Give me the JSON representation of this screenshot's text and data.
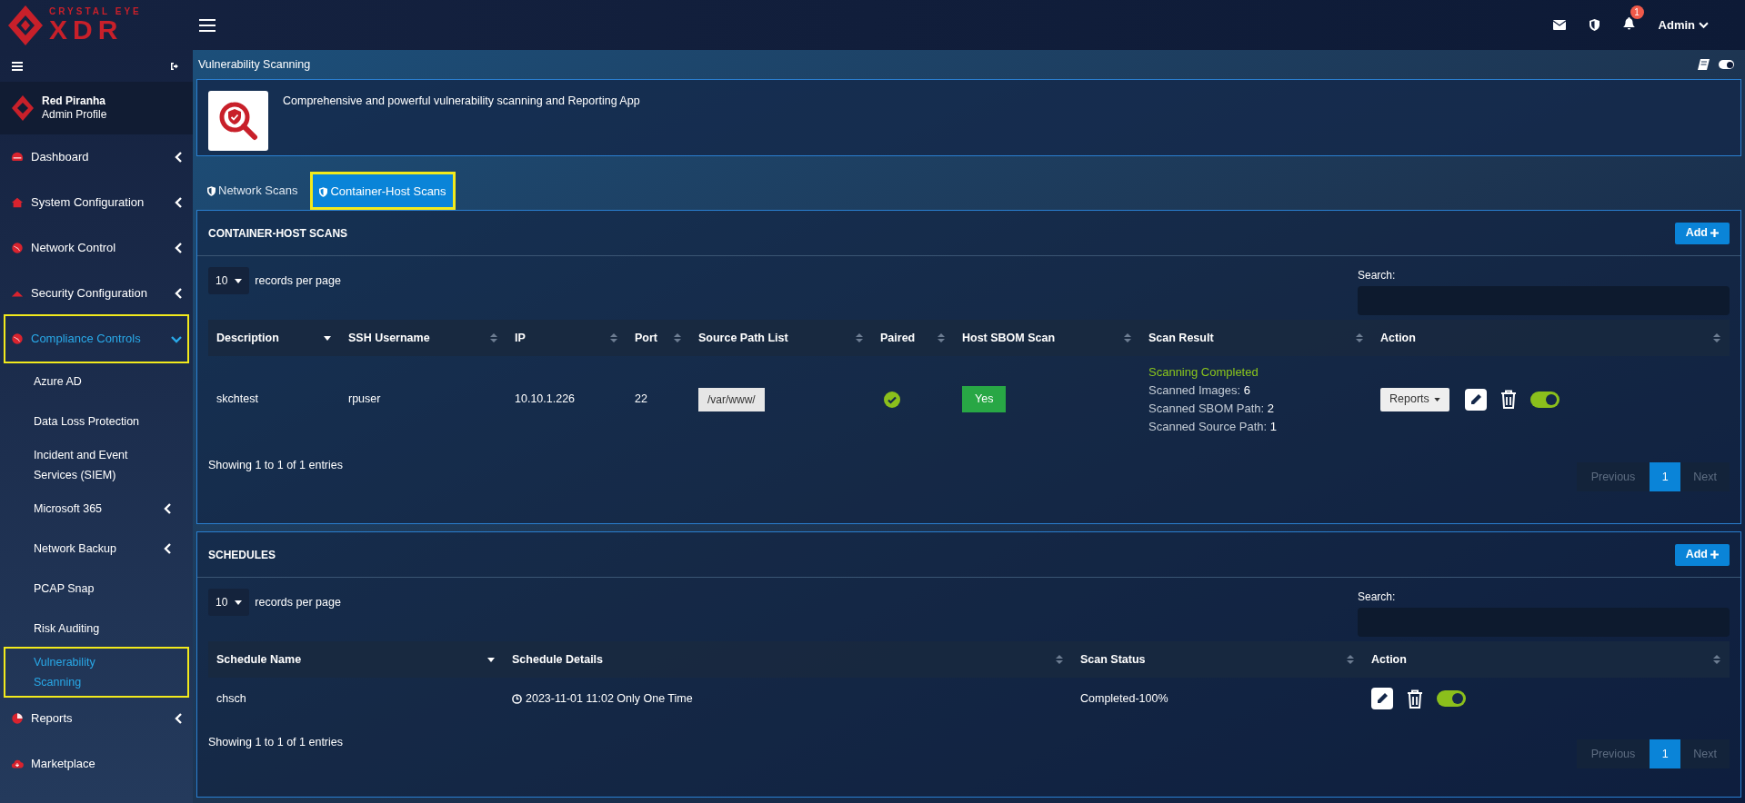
{
  "brand": {
    "line1": "CRYSTAL EYE",
    "line2": "XDR"
  },
  "topbar": {
    "notifications": "1",
    "user": "Admin"
  },
  "display_toggle": {
    "on": true
  },
  "profile": {
    "name": "Red Piranha",
    "role": "Admin Profile"
  },
  "nav": [
    {
      "label": "Dashboard",
      "expandable": true,
      "expanded": false,
      "selected": false,
      "highlighted": false
    },
    {
      "label": "System Configuration",
      "expandable": true,
      "expanded": false,
      "selected": false,
      "highlighted": false
    },
    {
      "label": "Network Control",
      "expandable": true,
      "expanded": false,
      "selected": false,
      "highlighted": false
    },
    {
      "label": "Security Configuration",
      "expandable": true,
      "expanded": false,
      "selected": false,
      "highlighted": false
    },
    {
      "label": "Compliance Controls",
      "expandable": true,
      "expanded": true,
      "selected": true,
      "highlighted": true,
      "children": [
        {
          "label": "Azure AD",
          "expandable": false,
          "selected": false,
          "highlighted": false
        },
        {
          "label": "Data Loss Protection",
          "expandable": false,
          "selected": false,
          "highlighted": false
        },
        {
          "label": "Incident and Event Services (SIEM)",
          "expandable": false,
          "selected": false,
          "highlighted": false
        },
        {
          "label": "Microsoft 365",
          "expandable": true,
          "selected": false,
          "highlighted": false
        },
        {
          "label": "Network Backup",
          "expandable": true,
          "selected": false,
          "highlighted": false
        },
        {
          "label": "PCAP Snap",
          "expandable": false,
          "selected": false,
          "highlighted": false
        },
        {
          "label": "Risk Auditing",
          "expandable": false,
          "selected": false,
          "highlighted": false
        },
        {
          "label": "Vulnerability Scanning",
          "expandable": false,
          "selected": true,
          "highlighted": true
        }
      ]
    },
    {
      "label": "Reports",
      "expandable": true,
      "expanded": false,
      "selected": false,
      "highlighted": false
    },
    {
      "label": "Marketplace",
      "expandable": false,
      "selected": false,
      "highlighted": false
    }
  ],
  "page": {
    "title": "Vulnerability Scanning",
    "description": "Comprehensive and powerful vulnerability scanning and Reporting App"
  },
  "tabs": [
    {
      "label": "Network Scans",
      "selected": false,
      "highlighted": false
    },
    {
      "label": "Container-Host Scans",
      "selected": true,
      "highlighted": true
    }
  ],
  "sections": [
    {
      "kind": "hosts",
      "title": "CONTAINER-HOST SCANS",
      "add_label": "Add",
      "length": "10",
      "length_label": "records per page",
      "search_label": "Search:",
      "columns": [
        "Description",
        "SSH Username",
        "IP",
        "Port",
        "Source Path List",
        "Paired",
        "Host SBOM Scan",
        "Scan Result",
        "Action"
      ],
      "rows": [
        {
          "cells": [
            {
              "kind": "text",
              "text": "skchtest"
            },
            {
              "kind": "text",
              "text": "rpuser"
            },
            {
              "kind": "text",
              "text": "10.10.1.226"
            },
            {
              "kind": "text",
              "text": "22"
            },
            {
              "kind": "tag",
              "text": "/var/www/"
            },
            {
              "kind": "check",
              "checked": true
            },
            {
              "kind": "badge",
              "text": "Yes"
            },
            {
              "kind": "result",
              "status": "Scanning Completed",
              "lines": [
                {
                  "label": "Scanned Images:",
                  "value": "6"
                },
                {
                  "label": "Scanned SBOM Path:",
                  "value": "2"
                },
                {
                  "label": "Scanned Source Path:",
                  "value": "1"
                }
              ]
            },
            {
              "kind": "actions",
              "reports": "Reports",
              "on": true
            }
          ]
        }
      ],
      "info": "Showing 1 to 1 of 1 entries",
      "pagination": {
        "previous": "Previous",
        "pages": [
          {
            "label": "1",
            "selected": true
          }
        ],
        "next": "Next"
      }
    },
    {
      "kind": "schedules",
      "title": "SCHEDULES",
      "add_label": "Add",
      "length": "10",
      "length_label": "records per page",
      "search_label": "Search:",
      "columns": [
        "Schedule Name",
        "Schedule Details",
        "Scan Status",
        "Action"
      ],
      "rows": [
        {
          "cells": [
            {
              "kind": "text",
              "text": "chsch"
            },
            {
              "kind": "datetime",
              "text": "2023-11-01 11:02 Only One Time"
            },
            {
              "kind": "text",
              "text": "Completed-100%"
            },
            {
              "kind": "actions",
              "on": true
            }
          ]
        }
      ],
      "info": "Showing 1 to 1 of 1 entries",
      "pagination": {
        "previous": "Previous",
        "pages": [
          {
            "label": "1",
            "selected": true
          }
        ],
        "next": "Next"
      }
    }
  ]
}
